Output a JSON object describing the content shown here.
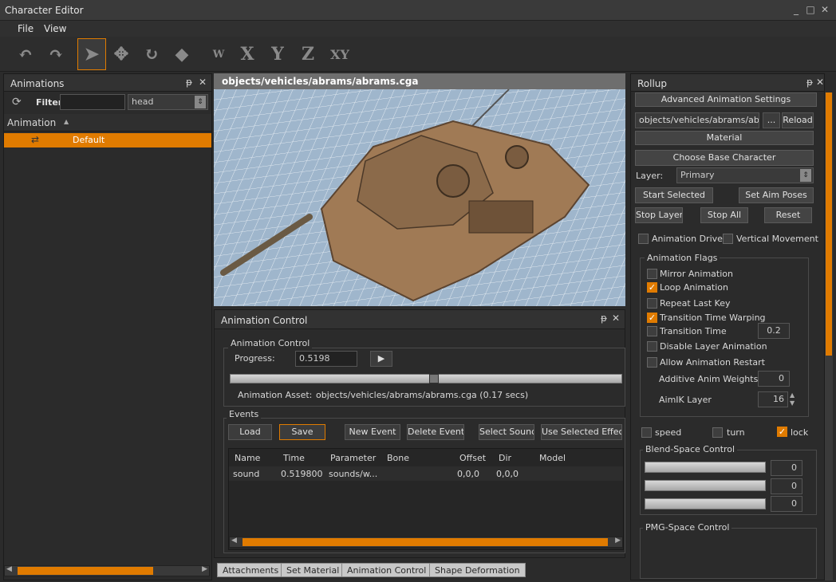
{
  "window": {
    "title": "Character Editor",
    "min": "_",
    "max": "□",
    "close": "✕"
  },
  "menu": {
    "file": "File",
    "view": "View"
  },
  "toolbar": {
    "undo": "↶",
    "redo": "↷",
    "select": "➤",
    "move": "✥",
    "rotate": "↻",
    "scale": "◆",
    "w": "W",
    "x": "X",
    "y": "Y",
    "z": "Z",
    "xy": "XY"
  },
  "animations": {
    "title": "Animations",
    "pin": "ᵽ",
    "close": "✕",
    "refresh": "⟳",
    "filter_label": "Filter",
    "filter_value": "",
    "preset_value": "head",
    "column_header": "Animation",
    "sort_arrow": "▲",
    "items": [
      {
        "label": "Default"
      }
    ]
  },
  "viewport": {
    "title": "objects/vehicles/abrams/abrams.cga"
  },
  "animation_control": {
    "title": "Animation Control",
    "group_label": "Animation Control",
    "progress_label": "Progress:",
    "progress_value": "0.5198",
    "play": "▶",
    "progress_fraction": 0.5198,
    "asset_label": "Animation Asset:",
    "asset_value": "objects/vehicles/abrams/abrams.cga (0.17 secs)",
    "events_label": "Events",
    "buttons": {
      "load": "Load",
      "save": "Save",
      "new_event": "New Event",
      "delete_event": "Delete Event",
      "select_sound": "Select Sound",
      "use_effect": "Use Selected Effect"
    },
    "table": {
      "headers": [
        "Name",
        "Time",
        "Parameter",
        "Bone",
        "Offset",
        "Dir",
        "Model"
      ],
      "rows": [
        [
          "sound",
          "0.519800",
          "sounds/w...",
          "",
          "0,0,0",
          "0,0,0",
          ""
        ]
      ]
    }
  },
  "tabs": [
    "Attachments",
    "Set Material",
    "Animation Control",
    "Shape Deformation"
  ],
  "rollup": {
    "title": "Rollup",
    "advanced": "Advanced Animation Settings",
    "path_value": "objects/vehicles/abrams/abram",
    "browse": "...",
    "reload": "Reload",
    "material": "Material",
    "choose_base": "Choose Base Character",
    "layer_label": "Layer:",
    "layer_value": "Primary",
    "start_selected": "Start Selected",
    "set_aim": "Set Aim Poses",
    "stop_layer": "Stop Layer",
    "stop_all": "Stop All",
    "reset": "Reset",
    "animation_driven": "Animation Driven",
    "vertical_movement": "Vertical Movement",
    "flags_label": "Animation Flags",
    "flags": [
      {
        "label": "Mirror Animation",
        "checked": false
      },
      {
        "label": "Loop Animation",
        "checked": true
      },
      {
        "label": "Repeat Last Key",
        "checked": false
      },
      {
        "label": "Transition Time Warping",
        "checked": true
      },
      {
        "label": "Transition Time",
        "checked": false
      },
      {
        "label": "Disable Layer Animation",
        "checked": false
      },
      {
        "label": "Allow Animation Restart",
        "checked": false
      }
    ],
    "transition_time_value": "0.2",
    "additive_label": "Additive Anim Weights",
    "additive_value": "0",
    "aimik_label": "AimIK Layer",
    "aimik_value": "16",
    "speed": "speed",
    "turn": "turn",
    "lock": "lock",
    "blend_label": "Blend-Space Control",
    "blend_values": [
      "0",
      "0",
      "0"
    ],
    "pmg_label": "PMG-Space Control"
  },
  "colors": {
    "accent": "#e07b00",
    "panel": "#2b2b2b",
    "grid": "#9fb6cc"
  }
}
